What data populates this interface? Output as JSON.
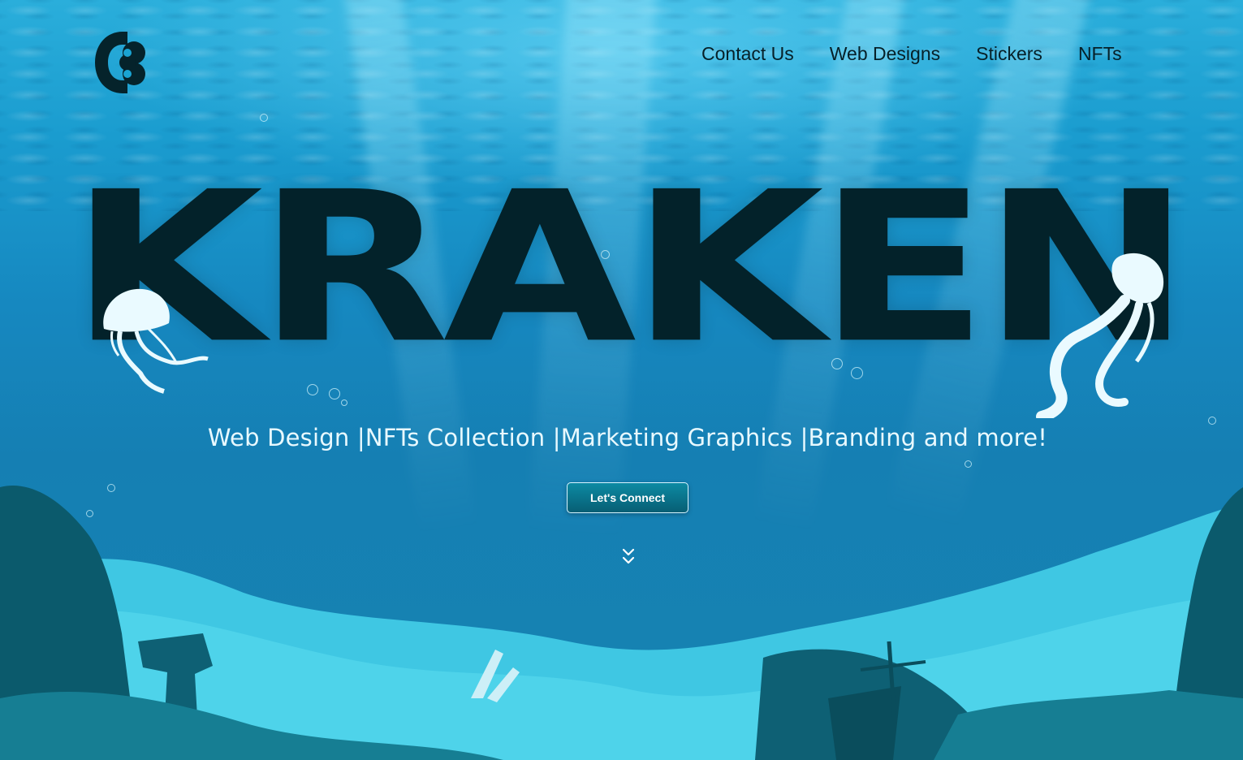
{
  "nav": {
    "logo_icon": "kraken-logo-icon",
    "items": [
      {
        "label": "Contact Us"
      },
      {
        "label": "Web Designs"
      },
      {
        "label": "Stickers"
      },
      {
        "label": "NFTs"
      }
    ]
  },
  "hero": {
    "title": "KRAKEN",
    "tagline": "Web Design |NFTs Collection |Marketing Graphics |Branding and more!",
    "cta_label": "Let's Connect",
    "scroll_icon": "chevron-double-down-icon"
  },
  "colors": {
    "title": "#03222a",
    "water_top": "#2aaedb",
    "water_bottom": "#157fb3",
    "reef_dark": "#0b5a6c",
    "reef_light": "#4ed3ea",
    "button": "#075e74"
  }
}
